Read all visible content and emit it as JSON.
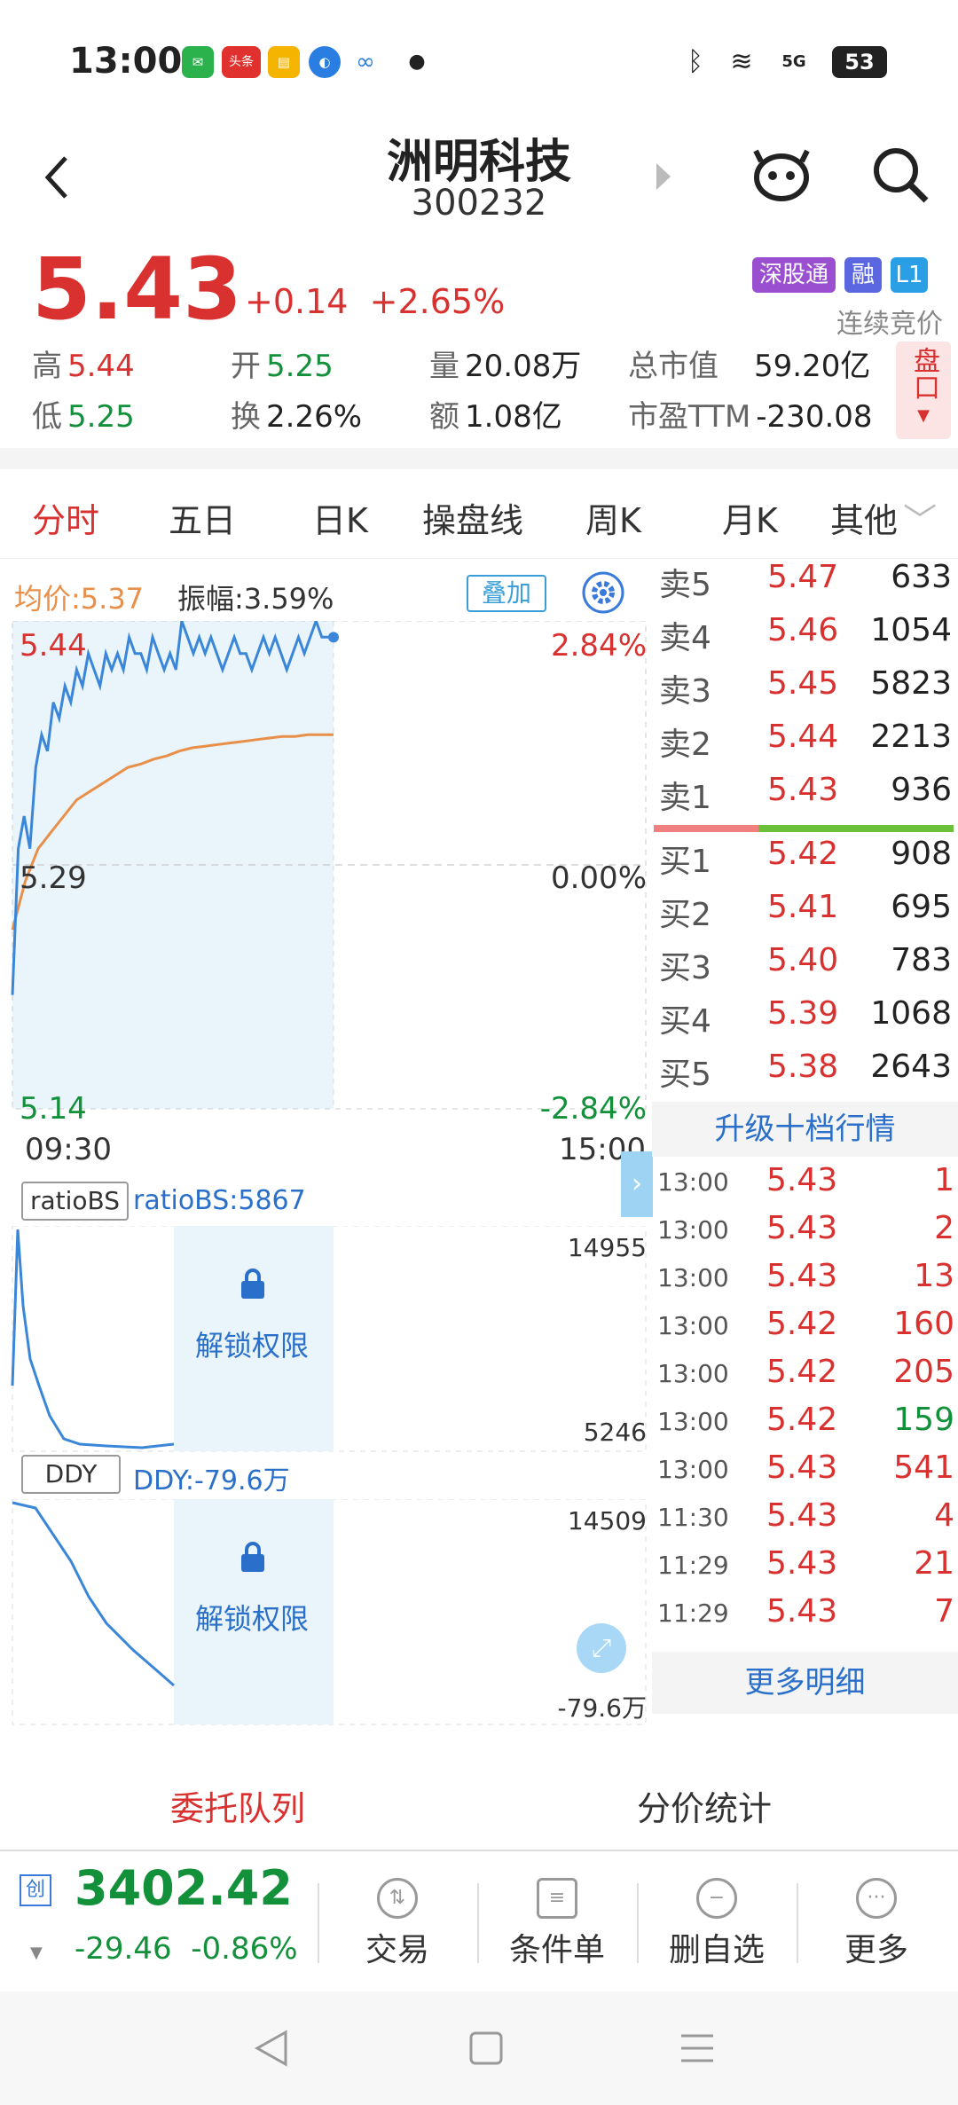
{
  "status": {
    "time": "13:00",
    "app1": "头条",
    "battery": "53",
    "network": "5G"
  },
  "header": {
    "title": "洲明科技",
    "code": "300232"
  },
  "quote": {
    "price": "5.43",
    "change": "+0.14",
    "pct": "+2.65%",
    "tags": [
      "深股通",
      "融",
      "L1"
    ],
    "session": "连续竞价"
  },
  "stats": {
    "high_l": "高",
    "high": "5.44",
    "open_l": "开",
    "open": "5.25",
    "vol_l": "量",
    "vol": "20.08万",
    "cap_l": "总市值",
    "cap": "59.20亿",
    "low_l": "低",
    "low": "5.25",
    "turn_l": "换",
    "turn": "2.26%",
    "amt_l": "额",
    "amt": "1.08亿",
    "pe_l": "市盈TTM",
    "pe": "-230.08",
    "pan": "盘口"
  },
  "tabs": [
    "分时",
    "五日",
    "日K",
    "操盘线",
    "周K",
    "月K",
    "其他"
  ],
  "intraday": {
    "avg": "均价:5.37",
    "amp": "振幅:3.59%",
    "overlay": "叠加",
    "top": "5.44",
    "topPct": "2.84%",
    "mid": "5.29",
    "midPct": "0.00%",
    "bot": "5.14",
    "botPct": "-2.84%",
    "t0": "09:30",
    "t1": "15:00",
    "ymin": 5.14,
    "ymax": 5.44,
    "price_series": [
      5.21,
      5.3,
      5.32,
      5.3,
      5.35,
      5.37,
      5.36,
      5.39,
      5.38,
      5.4,
      5.39,
      5.41,
      5.4,
      5.42,
      5.41,
      5.4,
      5.42,
      5.41,
      5.42,
      5.41,
      5.43,
      5.42,
      5.42,
      5.41,
      5.43,
      5.42,
      5.41,
      5.42,
      5.41,
      5.44,
      5.43,
      5.42,
      5.43,
      5.42,
      5.43,
      5.42,
      5.41,
      5.42,
      5.43,
      5.42,
      5.42,
      5.41,
      5.42,
      5.43,
      5.42,
      5.43,
      5.42,
      5.41,
      5.42,
      5.43,
      5.42,
      5.43,
      5.44,
      5.43,
      5.43,
      5.43
    ],
    "avg_series": [
      5.25,
      5.28,
      5.3,
      5.31,
      5.32,
      5.33,
      5.335,
      5.34,
      5.345,
      5.35,
      5.352,
      5.355,
      5.357,
      5.36,
      5.362,
      5.363,
      5.364,
      5.365,
      5.366,
      5.367,
      5.368,
      5.369,
      5.369,
      5.37,
      5.37,
      5.37
    ]
  },
  "ind1": {
    "name": "ratioBS",
    "value": "ratioBS:5867",
    "top": "14955",
    "bot": "5246",
    "lock": "解锁权限"
  },
  "ind2": {
    "name": "DDY",
    "value": "DDY:-79.6万",
    "top": "14509",
    "bot": "-79.6万",
    "lock": "解锁权限"
  },
  "asks": [
    {
      "l": "卖5",
      "p": "5.47",
      "v": "633"
    },
    {
      "l": "卖4",
      "p": "5.46",
      "v": "1054"
    },
    {
      "l": "卖3",
      "p": "5.45",
      "v": "5823"
    },
    {
      "l": "卖2",
      "p": "5.44",
      "v": "2213"
    },
    {
      "l": "卖1",
      "p": "5.43",
      "v": "936"
    }
  ],
  "bids": [
    {
      "l": "买1",
      "p": "5.42",
      "v": "908"
    },
    {
      "l": "买2",
      "p": "5.41",
      "v": "695"
    },
    {
      "l": "买3",
      "p": "5.40",
      "v": "783"
    },
    {
      "l": "买4",
      "p": "5.39",
      "v": "1068"
    },
    {
      "l": "买5",
      "p": "5.38",
      "v": "2643"
    }
  ],
  "upgrade": "升级十档行情",
  "ticks": [
    {
      "t": "13:00",
      "p": "5.43",
      "v": "1",
      "c": "red"
    },
    {
      "t": "13:00",
      "p": "5.43",
      "v": "2",
      "c": "red"
    },
    {
      "t": "13:00",
      "p": "5.43",
      "v": "13",
      "c": "red"
    },
    {
      "t": "13:00",
      "p": "5.42",
      "v": "160",
      "c": "red"
    },
    {
      "t": "13:00",
      "p": "5.42",
      "v": "205",
      "c": "red"
    },
    {
      "t": "13:00",
      "p": "5.42",
      "v": "159",
      "c": "green"
    },
    {
      "t": "13:00",
      "p": "5.43",
      "v": "541",
      "c": "red"
    },
    {
      "t": "11:30",
      "p": "5.43",
      "v": "4",
      "c": "red"
    },
    {
      "t": "11:29",
      "p": "5.43",
      "v": "21",
      "c": "red"
    },
    {
      "t": "11:29",
      "p": "5.43",
      "v": "7",
      "c": "red"
    }
  ],
  "more": "更多明细",
  "bottomtabs": [
    "委托队列",
    "分价统计"
  ],
  "index": {
    "tag": "创",
    "value": "3402.42",
    "chg": "-29.46",
    "pct": "-0.86%"
  },
  "dock": [
    "交易",
    "条件单",
    "删自选",
    "更多"
  ],
  "colors": {
    "red": "#d8312f",
    "green": "#12903a",
    "blue": "#3a86d9",
    "orange": "#e8904a"
  }
}
